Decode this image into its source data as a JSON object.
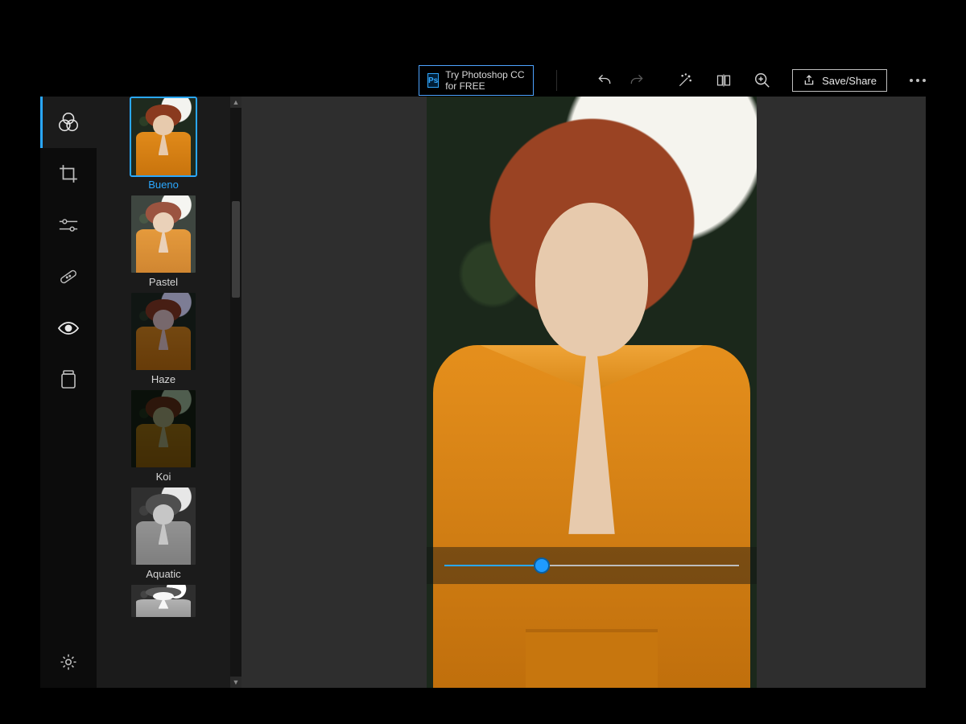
{
  "colors": {
    "accent": "#2aa8ff"
  },
  "topbar": {
    "try_ps_label": "Try Photoshop CC for FREE",
    "ps_badge": "Ps",
    "save_share_label": "Save/Share"
  },
  "rail": {
    "items": [
      {
        "id": "looks",
        "name": "looks-tool",
        "icon": "overlapping-circles-icon",
        "active": true
      },
      {
        "id": "crop",
        "name": "crop-tool",
        "icon": "crop-icon",
        "active": false
      },
      {
        "id": "adjust",
        "name": "adjustments-tool",
        "icon": "sliders-icon",
        "active": false
      },
      {
        "id": "heal",
        "name": "heal-tool",
        "icon": "bandage-icon",
        "active": false
      },
      {
        "id": "redeye",
        "name": "redeye-tool",
        "icon": "eye-icon",
        "active": false
      },
      {
        "id": "border",
        "name": "border-tool",
        "icon": "jar-icon",
        "active": false
      }
    ],
    "settings_name": "settings-button",
    "settings_icon": "gear-icon"
  },
  "filters": {
    "selected_index": 0,
    "items": [
      {
        "label": "Bueno",
        "tint": ""
      },
      {
        "label": "Pastel",
        "tint": "t-pastel"
      },
      {
        "label": "Haze",
        "tint": "t-haze"
      },
      {
        "label": "Koi",
        "tint": "t-koi"
      },
      {
        "label": "Aquatic",
        "tint": "t-aquatic"
      },
      {
        "label": "",
        "tint": "t-last"
      }
    ]
  },
  "slider": {
    "value_pct": 33
  }
}
